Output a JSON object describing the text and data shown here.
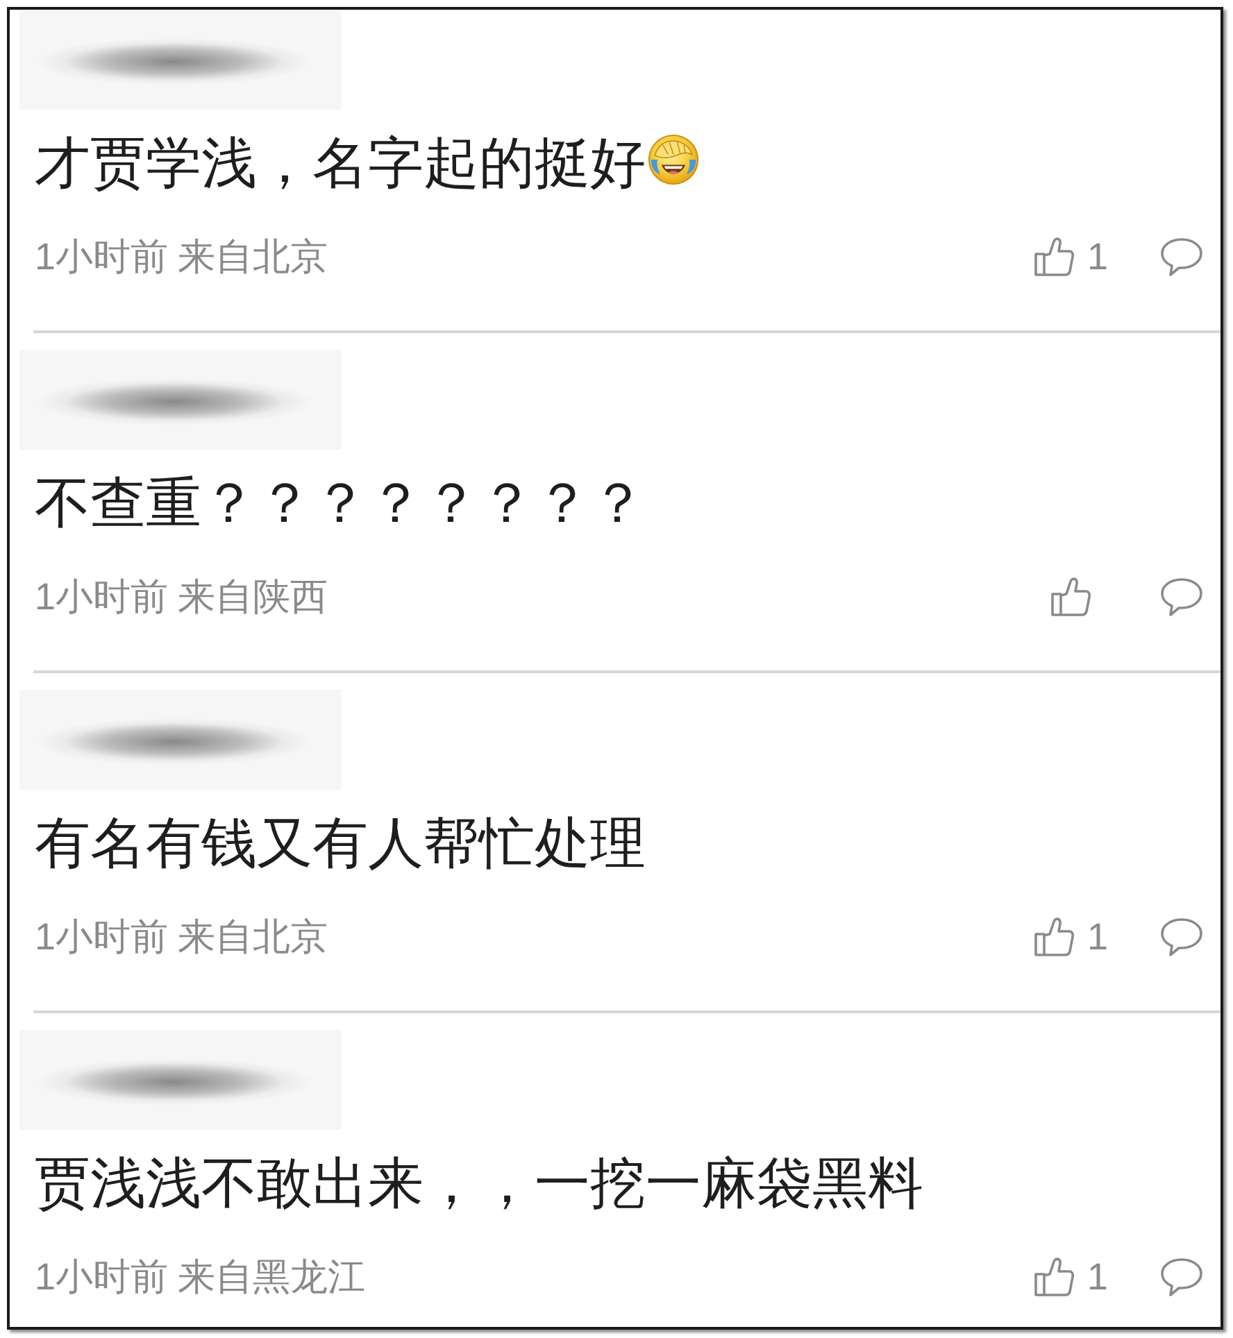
{
  "comments": [
    {
      "author_blurred": true,
      "text": "才贾学浅，名字起的挺好",
      "emoji": true,
      "time": "1小时前",
      "location": "来自北京",
      "likes": "1"
    },
    {
      "author_blurred": true,
      "text": "不查重？？？？？？？？",
      "emoji": false,
      "time": "1小时前",
      "location": "来自陕西"
    },
    {
      "author_blurred": true,
      "text": "有名有钱又有人帮忙处理",
      "emoji": false,
      "time": "1小时前",
      "location": "来自北京",
      "likes": "1"
    },
    {
      "author_blurred": true,
      "text": "贾浅浅不敢出来，，一挖一麻袋黑料",
      "emoji": false,
      "time": "1小时前",
      "location": "来自黑龙江",
      "likes": "1"
    }
  ]
}
